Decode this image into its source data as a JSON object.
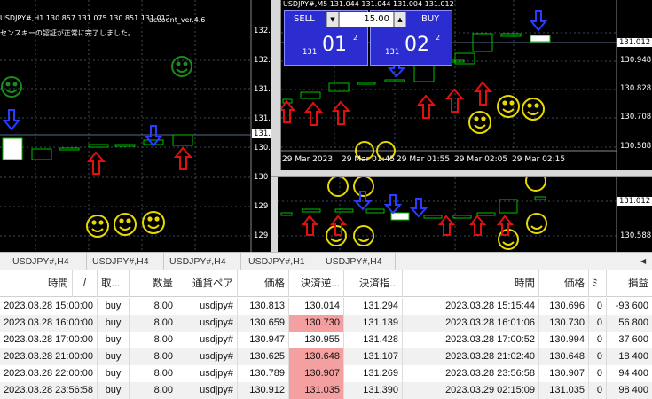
{
  "left_chart": {
    "title": "USDJPY#,H1  130.857 131.075 130.851 131.012",
    "indicator": "account_ver.4.6",
    "status_msg": "センスキーの認証が正常に完了しました。",
    "price_labels": [
      "132.",
      "132.",
      "131.",
      "131.",
      "130.",
      "130",
      "129",
      "129"
    ],
    "price_tag": "131."
  },
  "top_chart": {
    "title": "USDJPY#,M5  131.044 131.044 131.004 131.012",
    "prices": [
      "130.948",
      "130.828",
      "130.708",
      "130.588"
    ],
    "price_tag": "131.012",
    "time_labels": [
      "29 Mar 2023",
      "29 Mar 01:45",
      "29 Mar 01:55",
      "29 Mar 02:05",
      "29 Mar 02:15"
    ]
  },
  "one_click": {
    "sell_label": "SELL",
    "buy_label": "BUY",
    "volume": "15.00",
    "spin_down": "▼",
    "spin_up": "▲",
    "sell_prefix": "131",
    "sell_big": "01",
    "sell_sup": "2",
    "buy_prefix": "131",
    "buy_big": "02",
    "buy_sup": "2"
  },
  "bottom_chart": {
    "prices": [
      "131.012",
      "130.588"
    ]
  },
  "tabs": [
    "USDJPY#,H4",
    "USDJPY#,H4",
    "USDJPY#,H4",
    "USDJPY#,H1",
    "USDJPY#,H4"
  ],
  "tab_arrow": "◀",
  "table": {
    "headers": [
      "時間",
      "/",
      "取...",
      "数量",
      "通貨ペア",
      "価格",
      "決済逆...",
      "決済指...",
      "時間",
      "価格",
      "ﾐ",
      "損益"
    ],
    "rows": [
      [
        "2023.03.28 15:00:00",
        "buy",
        "8.00",
        "usdjpy#",
        "130.813",
        "130.014",
        "131.294",
        "2023.03.28 15:15:44",
        "130.696",
        "0",
        "-93 600"
      ],
      [
        "2023.03.28 16:00:00",
        "buy",
        "8.00",
        "usdjpy#",
        "130.659",
        "130.730",
        "131.139",
        "2023.03.28 16:01:06",
        "130.730",
        "0",
        "56 800"
      ],
      [
        "2023.03.28 17:00:00",
        "buy",
        "8.00",
        "usdjpy#",
        "130.947",
        "130.955",
        "131.428",
        "2023.03.28 17:00:52",
        "130.994",
        "0",
        "37 600"
      ],
      [
        "2023.03.28 21:00:00",
        "buy",
        "8.00",
        "usdjpy#",
        "130.625",
        "130.648",
        "131.107",
        "2023.03.28 21:02:40",
        "130.648",
        "0",
        "18 400"
      ],
      [
        "2023.03.28 22:00:00",
        "buy",
        "8.00",
        "usdjpy#",
        "130.789",
        "130.907",
        "131.269",
        "2023.03.28 23:56:58",
        "130.907",
        "0",
        "94 400"
      ],
      [
        "2023.03.28 23:56:58",
        "buy",
        "8.00",
        "usdjpy#",
        "130.912",
        "131.035",
        "131.390",
        "2023.03.29 02:15:09",
        "131.035",
        "0",
        "98 400"
      ]
    ],
    "highlight_rows": [
      1,
      3,
      4,
      5
    ],
    "colors": {
      "stop_highlight": "#f4a0a0"
    }
  }
}
